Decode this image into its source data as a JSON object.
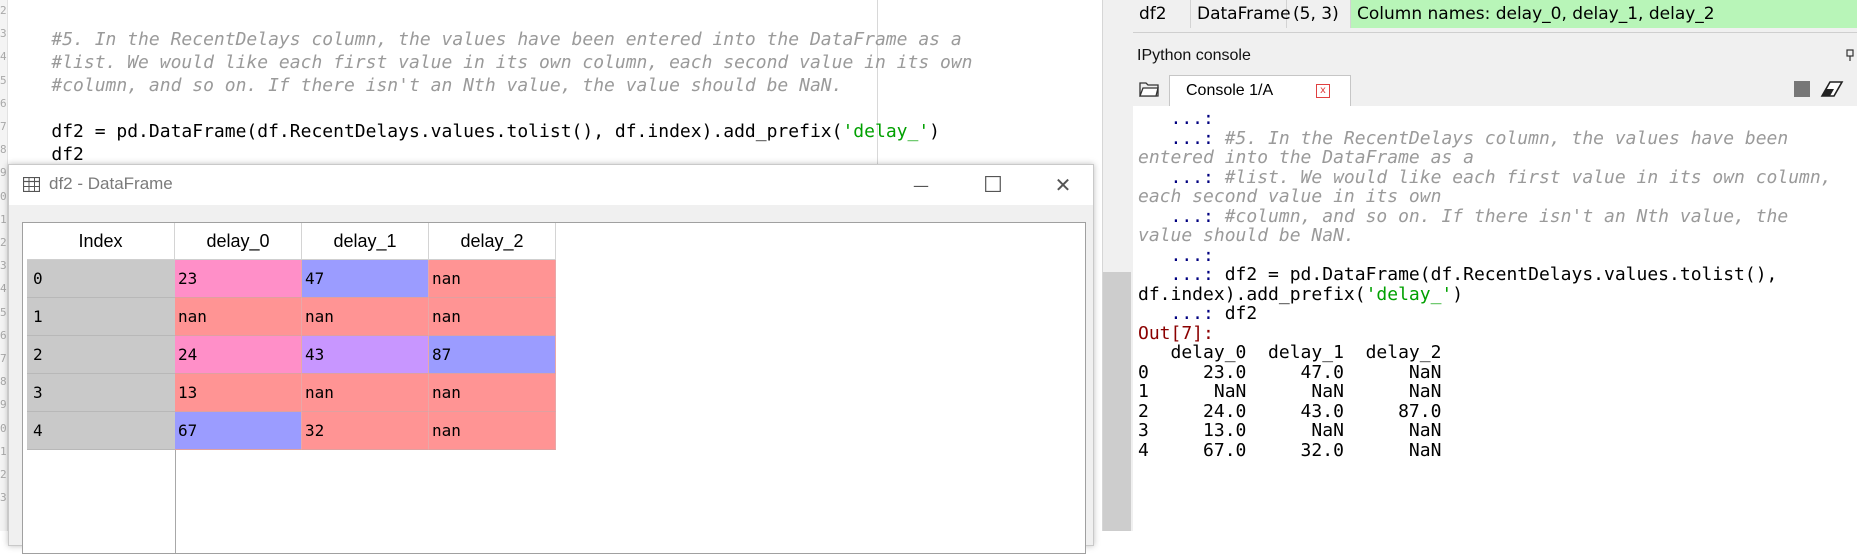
{
  "editor": {
    "gutter_digits": [
      "2",
      "3",
      "4",
      "5",
      "6",
      "7",
      "8",
      "9",
      "0",
      "1",
      "2",
      "3",
      "4",
      "5",
      "6",
      "7",
      "8",
      "9",
      "0",
      "1",
      "2",
      "3"
    ],
    "lines": [
      {
        "comment": "#5. In the RecentDelays column, the values have been entered into the DataFrame as a"
      },
      {
        "comment": "#list. We would like each first value in its own column, each second value in its own"
      },
      {
        "comment": "#column, and so on. If there isn't an Nth value, the value should be NaN."
      },
      {
        "code_before": "df2 = pd.DataFrame(df.RecentDelays.values.tolist(), df.index).add_prefix(",
        "string": "'delay_'",
        "code_after": ")"
      },
      {
        "code": "df2"
      }
    ]
  },
  "dialog": {
    "title": "df2 - DataFrame",
    "minimize_glyph": "—",
    "maximize_glyph": "☐",
    "close_glyph": "✕",
    "index_header": "Index",
    "columns": [
      "delay_0",
      "delay_1",
      "delay_2"
    ],
    "rows": [
      {
        "index": "0",
        "cells": [
          {
            "v": "23",
            "color": "#ff8fc8"
          },
          {
            "v": "47",
            "color": "#9b9cff"
          },
          {
            "v": "nan",
            "color": "#ff9494"
          }
        ]
      },
      {
        "index": "1",
        "cells": [
          {
            "v": "nan",
            "color": "#ff9494"
          },
          {
            "v": "nan",
            "color": "#ff9494"
          },
          {
            "v": "nan",
            "color": "#ff9494"
          }
        ]
      },
      {
        "index": "2",
        "cells": [
          {
            "v": "24",
            "color": "#ff8fc8"
          },
          {
            "v": "43",
            "color": "#c896ff"
          },
          {
            "v": "87",
            "color": "#9b9cff"
          }
        ]
      },
      {
        "index": "3",
        "cells": [
          {
            "v": "13",
            "color": "#ff9494"
          },
          {
            "v": "nan",
            "color": "#ff9494"
          },
          {
            "v": "nan",
            "color": "#ff9494"
          }
        ]
      },
      {
        "index": "4",
        "cells": [
          {
            "v": "67",
            "color": "#9b9cff"
          },
          {
            "v": "32",
            "color": "#ff9494"
          },
          {
            "v": "nan",
            "color": "#ff9494"
          }
        ]
      }
    ]
  },
  "variable_explorer": {
    "name": "df2",
    "type": "DataFrame",
    "size": "(5, 3)",
    "value": "Column names: delay_0, delay_1, delay_2",
    "value_bg": "#b8f5b8"
  },
  "console": {
    "pane_title": "IPython console",
    "tab_label": "Console 1/A",
    "tab_close_glyph": "x",
    "lines": [
      {
        "prompt": "   ...:",
        "text": ""
      },
      {
        "prompt": "   ...: ",
        "comment": "#5. In the RecentDelays column, the values have been"
      },
      {
        "comment": "entered into the DataFrame as a"
      },
      {
        "prompt": "   ...: ",
        "comment": "#list. We would like each first value in its own column,"
      },
      {
        "comment": "each second value in its own"
      },
      {
        "prompt": "   ...: ",
        "comment": "#column, and so on. If there isn't an Nth value, the"
      },
      {
        "comment": "value should be NaN."
      },
      {
        "prompt": "   ...:",
        "text": ""
      },
      {
        "prompt": "   ...: ",
        "text": "df2 = pd.DataFrame(df.RecentDelays.values.tolist(),"
      },
      {
        "text": "df.index).add_prefix(",
        "string": "'delay_'",
        "text_after": ")"
      },
      {
        "prompt": "   ...: ",
        "text": "df2"
      },
      {
        "out": "Out[7]:"
      },
      {
        "text": "   delay_0  delay_1  delay_2"
      },
      {
        "text": "0     23.0     47.0      NaN"
      },
      {
        "text": "1      NaN      NaN      NaN"
      },
      {
        "text": "2     24.0     43.0     87.0"
      },
      {
        "text": "3     13.0      NaN      NaN"
      },
      {
        "text": "4     67.0     32.0      NaN"
      }
    ]
  }
}
